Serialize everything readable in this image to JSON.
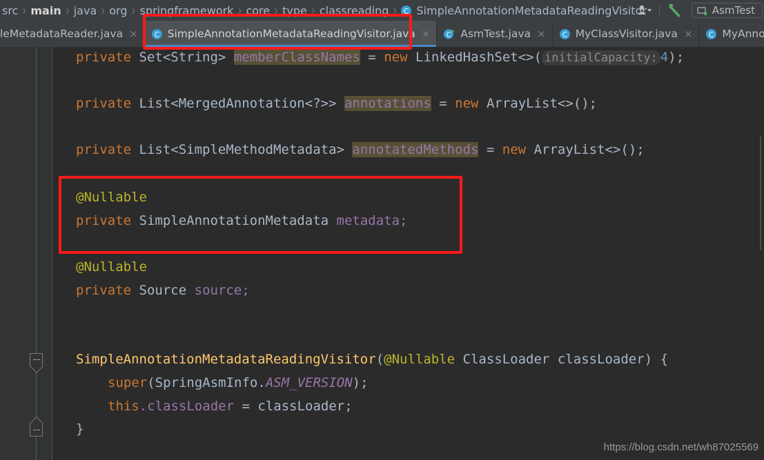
{
  "breadcrumb": {
    "items": [
      {
        "label": "src",
        "bold": false
      },
      {
        "label": "main",
        "bold": true
      },
      {
        "label": "java",
        "bold": false
      },
      {
        "label": "org",
        "bold": false
      },
      {
        "label": "springframework",
        "bold": false
      },
      {
        "label": "core",
        "bold": false
      },
      {
        "label": "type",
        "bold": false
      },
      {
        "label": "classreading",
        "bold": false
      }
    ],
    "separator": "›",
    "class_name": "SimpleAnnotationMetadataReadingVisitor",
    "class_icon": "java-class-icon"
  },
  "toolbar": {
    "avatar_icon": "user-avatar-icon",
    "avatar_dropdown_icon": "chevron-down-icon",
    "build_icon": "build-hammer-icon",
    "run_config_icon": "run-configuration-icon",
    "run_config_label": "AsmTest"
  },
  "tabs": [
    {
      "label": "leMetadataReader.java",
      "icon": "java-class-icon",
      "active": false,
      "clipped": true,
      "close": "×"
    },
    {
      "label": "SimpleAnnotationMetadataReadingVisitor.java",
      "icon": "java-class-icon",
      "active": true,
      "clipped": false,
      "close": "×"
    },
    {
      "label": "AsmTest.java",
      "icon": "java-runnable-class-icon",
      "active": false,
      "clipped": false,
      "close": "×"
    },
    {
      "label": "MyClassVisitor.java",
      "icon": "java-class-icon",
      "active": false,
      "clipped": false,
      "close": "×"
    },
    {
      "label": "MyAnnotationV",
      "icon": "java-class-icon",
      "active": false,
      "clipped": true,
      "close": ""
    }
  ],
  "code": {
    "line1": {
      "kw_private": "private",
      "type": "Set<String>",
      "field": "memberClassNames",
      "eq": "=",
      "kw_new": "new",
      "ctor_type": "LinkedHashSet<>(",
      "hint_label": "initialCapacity:",
      "hint_value": "4",
      "tail": ");"
    },
    "line2": {
      "kw_private": "private",
      "type": "List<MergedAnnotation<?>>",
      "field": "annotations",
      "eq": "=",
      "kw_new": "new",
      "tail": "ArrayList<>();"
    },
    "line3": {
      "kw_private": "private",
      "type": "List<SimpleMethodMetadata>",
      "field": "annotatedMethods",
      "eq": "=",
      "kw_new": "new",
      "tail": "ArrayList<>();"
    },
    "line4": {
      "annotation": "@Nullable",
      "kw_private": "private",
      "type": "SimpleAnnotationMetadata",
      "field": "metadata;"
    },
    "line5": {
      "annotation": "@Nullable",
      "kw_private": "private",
      "type": "Source",
      "field": "source;"
    },
    "constructor": {
      "name": "SimpleAnnotationMetadataReadingVisitor",
      "open_paren": "(",
      "annotation": "@Nullable",
      "param_type": "ClassLoader",
      "param_name": "classLoader",
      "tail": ") {"
    },
    "body1": {
      "kw_super": "super",
      "open": "(",
      "type": "SpringAsmInfo.",
      "constant": "ASM_VERSION",
      "tail": ");"
    },
    "body2": {
      "kw_this": "this",
      "dot_field": ".classLoader",
      "eq": "=",
      "value": "classLoader;"
    },
    "closing_brace": "}"
  },
  "watermark": "https://blog.csdn.net/wh87025569"
}
